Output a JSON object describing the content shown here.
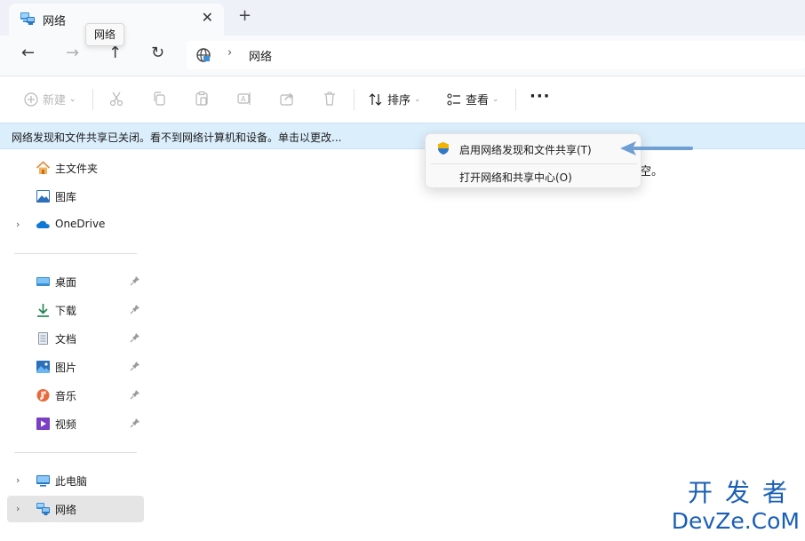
{
  "tab": {
    "title": "网络",
    "close_glyph": "✕",
    "new_glyph": "+"
  },
  "tooltip": "网络",
  "nav": {
    "back": "←",
    "forward": "→",
    "up": "↑",
    "refresh": "↻",
    "breadcrumb_separator": "›",
    "location": "网络"
  },
  "commandbar": {
    "new_label": "新建",
    "sort_label": "排序",
    "view_label": "查看",
    "more_label": "···",
    "chevron": "⌄"
  },
  "infobar": {
    "text": "网络发现和文件共享已关闭。看不到网络计算机和设备。单击以更改..."
  },
  "sidebar": {
    "items": [
      {
        "label": "主文件夹",
        "icon": "home-icon"
      },
      {
        "label": "图库",
        "icon": "gallery-icon"
      },
      {
        "label": "OneDrive",
        "icon": "onedrive-icon",
        "expander": "›"
      },
      {
        "label": "桌面",
        "icon": "desktop-icon"
      },
      {
        "label": "下载",
        "icon": "download-icon"
      },
      {
        "label": "文档",
        "icon": "documents-icon"
      },
      {
        "label": "图片",
        "icon": "pictures-icon"
      },
      {
        "label": "音乐",
        "icon": "music-icon"
      },
      {
        "label": "视频",
        "icon": "videos-icon"
      },
      {
        "label": "此电脑",
        "icon": "this-pc-icon",
        "expander": "›"
      },
      {
        "label": "网络",
        "icon": "network-icon",
        "expander": "›"
      }
    ]
  },
  "content": {
    "empty_text_fragment": "空。"
  },
  "context_menu": {
    "items": [
      {
        "label": "启用网络发现和文件共享(T)",
        "icon": "shield-icon"
      },
      {
        "label": "打开网络和共享中心(O)"
      }
    ]
  },
  "watermark": {
    "cn": "开发者",
    "en": "DevZe.CoM"
  },
  "colors": {
    "tabbar_bg": "#eef2f8",
    "infobar_bg": "#dbeefc",
    "accent": "#0067c0",
    "arrow": "#6f9fd3",
    "watermark": "#1a5fb4"
  }
}
